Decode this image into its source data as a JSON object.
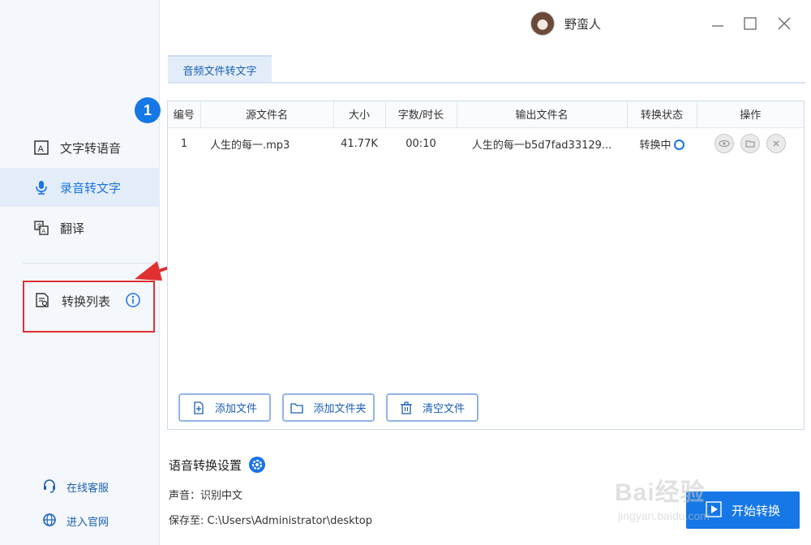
{
  "user": {
    "name": "野蛮人"
  },
  "sidebar": {
    "badge": "1",
    "items": [
      {
        "label": "文字转语音",
        "icon": "text-box-icon"
      },
      {
        "label": "录音转文字",
        "icon": "microphone-icon"
      },
      {
        "label": "翻译",
        "icon": "translate-icon"
      }
    ],
    "convert_list": {
      "label": "转换列表",
      "icon": "document-list-icon"
    },
    "footer": [
      {
        "label": "在线客服",
        "icon": "headset-icon"
      },
      {
        "label": "进入官网",
        "icon": "globe-icon"
      }
    ]
  },
  "tabs": [
    {
      "label": "音频文件转文字"
    }
  ],
  "table": {
    "headers": [
      "编号",
      "源文件名",
      "大小",
      "字数/时长",
      "输出文件名",
      "转换状态",
      "操作"
    ],
    "rows": [
      {
        "no": "1",
        "source": "人生的每一.mp3",
        "size": "41.77K",
        "duration": "00:10",
        "output": "人生的每一b5d7fad33129...",
        "status": "转换中"
      }
    ]
  },
  "buttons": {
    "add_file": "添加文件",
    "add_folder": "添加文件夹",
    "clear": "清空文件"
  },
  "settings": {
    "title": "语音转换设置",
    "voice": "声音：识别中文",
    "save_to": "保存至: C:\\Users\\Administrator\\desktop"
  },
  "start_button": "开始转换",
  "watermark": {
    "text": "Bai经验",
    "sub": "jingyan.baidu.com"
  },
  "colors": {
    "accent": "#1677e6",
    "highlight": "#e03030",
    "sidebar_bg": "#f4f7fb"
  }
}
